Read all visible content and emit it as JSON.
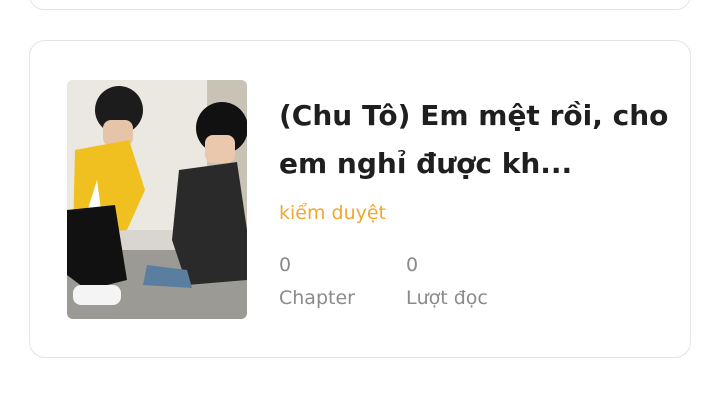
{
  "story": {
    "title": "(Chu Tô) Em mệt rồi, cho em nghỉ được kh...",
    "status": "kiểm duyệt",
    "stats": {
      "chapter_count": "0",
      "chapter_label": "Chapter",
      "read_count": "0",
      "read_label": "Lượt đọc"
    }
  },
  "colors": {
    "status_color": "#f0a830",
    "title_color": "#1f1f1f",
    "stat_color": "#8a8a8a",
    "card_border": "#e4e4e4"
  }
}
